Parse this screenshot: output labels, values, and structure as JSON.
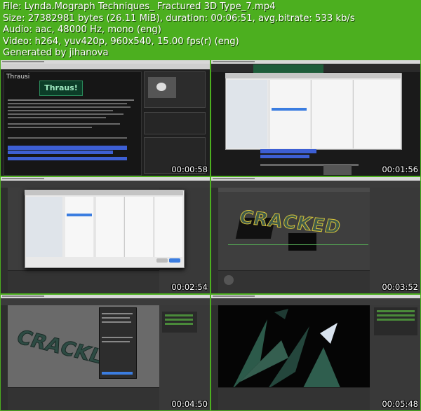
{
  "info": {
    "file": "File: Lynda.Mograph Techniques_ Fractured 3D Type_7.mp4",
    "size": "Size: 27382981 bytes (26.11 MiB), duration: 00:06:51, avg.bitrate: 533 kb/s",
    "audio": "Audio: aac, 48000 Hz, mono (eng)",
    "video": "Video: h264, yuv420p, 960x540, 15.00 fps(r) (eng)",
    "generated": "Generated by jihanova"
  },
  "thumbnails": [
    {
      "timestamp": "00:00:58",
      "site_title": "Thrausi",
      "logo_text": "Thraus!"
    },
    {
      "timestamp": "00:01:56"
    },
    {
      "timestamp": "00:02:54"
    },
    {
      "timestamp": "00:03:52",
      "text3d": "CRACKED"
    },
    {
      "timestamp": "00:04:50",
      "text3d": "CRACKLE"
    },
    {
      "timestamp": "00:05:48"
    }
  ],
  "colors": {
    "background": "#4caf1f",
    "text": "#ffffff"
  }
}
